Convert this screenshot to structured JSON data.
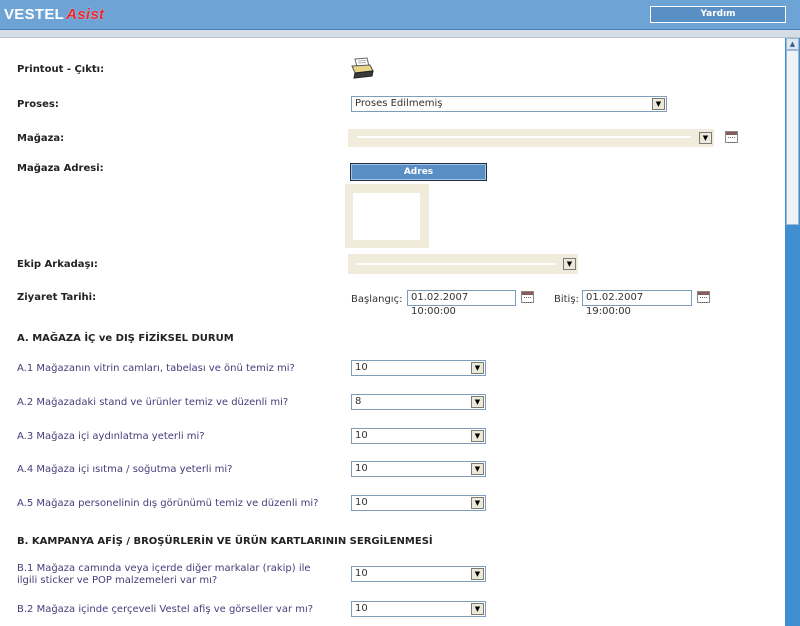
{
  "header": {
    "logo_main": "VESTEL",
    "logo_accent": "Asist",
    "help_label": "Yardım"
  },
  "form": {
    "printout_label": "Printout - Çıktı:",
    "proses_label": "Proses:",
    "proses_value": "Proses Edilmemiş",
    "magaza_label": "Mağaza:",
    "magaza_value": "",
    "magaza_adresi_label": "Mağaza Adresi:",
    "adres_button": "Adres",
    "ekip_label": "Ekip Arkadaşı:",
    "ekip_value": "",
    "ziyaret_label": "Ziyaret Tarihi:",
    "baslangic_label": "Başlangıç:",
    "baslangic_value": "01.02.2007 10:00:00",
    "bitis_label": "Bitiş:",
    "bitis_value": "01.02.2007 19:00:00"
  },
  "section_a": {
    "title": "A. MAĞAZA İÇ ve DIŞ FİZİKSEL DURUM",
    "questions": [
      {
        "text": "A.1 Mağazanın vitrin camları, tabelası ve önü temiz mi?",
        "value": "10"
      },
      {
        "text": "A.2 Mağazadaki stand ve ürünler temiz ve düzenli mi?",
        "value": "8"
      },
      {
        "text": "A.3 Mağaza içi aydınlatma yeterli mi?",
        "value": "10"
      },
      {
        "text": "A.4 Mağaza içi ısıtma / soğutma yeterli mi?",
        "value": "10"
      },
      {
        "text": "A.5 Mağaza personelinin dış görünümü temiz ve düzenli mi?",
        "value": "10"
      }
    ]
  },
  "section_b": {
    "title": "B. KAMPANYA AFİŞ / BROŞÜRLERİN VE ÜRÜN KARTLARININ SERGİLENMESİ",
    "questions": [
      {
        "text_line1": "B.1 Mağaza camında veya içerde diğer markalar (rakip) ile",
        "text_line2": "ilgili sticker ve POP malzemeleri var mı?",
        "value": "10"
      },
      {
        "text_line1": "B.2 Mağaza içinde çerçeveli Vestel afiş ve görseller var mı?",
        "text_line2": "",
        "value": "10"
      }
    ]
  },
  "icons": {
    "printer": "printer-icon",
    "calendar": "calendar-icon",
    "dropdown": "chevron-down-icon"
  }
}
